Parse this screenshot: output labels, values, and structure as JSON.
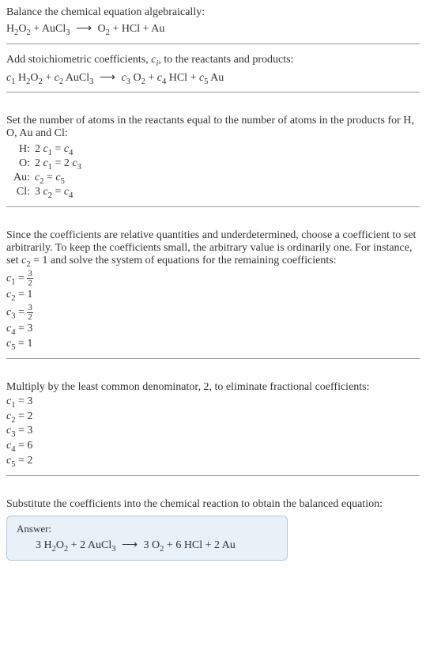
{
  "intro": {
    "line1": "Balance the chemical equation algebraically:",
    "eq_lhs1": "H",
    "eq_lhs1_sub1": "2",
    "eq_lhs1_mid": "O",
    "eq_lhs1_sub2": "2",
    "eq_plus1": " + AuCl",
    "eq_lhs2_sub": "3",
    "arrow": "⟶",
    "eq_rhs1": "O",
    "eq_rhs1_sub": "2",
    "eq_plus2": " + HCl + Au"
  },
  "stoich": {
    "text": "Add stoichiometric coefficients, ",
    "ci": "c",
    "ci_sub": "i",
    "text2": ", to the reactants and products:",
    "c1": "c",
    "c1_sub": "1",
    "sp1": " H",
    "sp1_sub1": "2",
    "sp1_mid": "O",
    "sp1_sub2": "2",
    "plus1": " + ",
    "c2": "c",
    "c2_sub": "2",
    "sp2": " AuCl",
    "sp2_sub": "3",
    "arrow": "⟶",
    "c3": "c",
    "c3_sub": "3",
    "sp3": " O",
    "sp3_sub": "2",
    "plus2": " + ",
    "c4": "c",
    "c4_sub": "4",
    "sp4": " HCl + ",
    "c5": "c",
    "c5_sub": "5",
    "sp5": " Au"
  },
  "atoms": {
    "intro": "Set the number of atoms in the reactants equal to the number of atoms in the products for H, O, Au and Cl:",
    "rows": [
      {
        "label": "H:",
        "eq_pre": "2 ",
        "c_a": "c",
        "c_a_sub": "1",
        "mid": " = ",
        "c_b": "c",
        "c_b_sub": "4",
        "post": ""
      },
      {
        "label": "O:",
        "eq_pre": "2 ",
        "c_a": "c",
        "c_a_sub": "1",
        "mid": " = 2 ",
        "c_b": "c",
        "c_b_sub": "3",
        "post": ""
      },
      {
        "label": "Au:",
        "eq_pre": "",
        "c_a": "c",
        "c_a_sub": "2",
        "mid": " = ",
        "c_b": "c",
        "c_b_sub": "5",
        "post": ""
      },
      {
        "label": "Cl:",
        "eq_pre": "3 ",
        "c_a": "c",
        "c_a_sub": "2",
        "mid": " = ",
        "c_b": "c",
        "c_b_sub": "4",
        "post": ""
      }
    ]
  },
  "solve": {
    "text": "Since the coefficients are relative quantities and underdetermined, choose a coefficient to set arbitrarily. To keep the coefficients small, the arbitrary value is ordinarily one. For instance, set ",
    "cset": "c",
    "cset_sub": "2",
    "text2": " = 1 and solve the system of equations for the remaining coefficients:",
    "items": [
      {
        "c": "c",
        "sub": "1",
        "eq": " = ",
        "frac_num": "3",
        "frac_den": "2",
        "val": ""
      },
      {
        "c": "c",
        "sub": "2",
        "eq": " = 1",
        "frac_num": "",
        "frac_den": "",
        "val": ""
      },
      {
        "c": "c",
        "sub": "3",
        "eq": " = ",
        "frac_num": "3",
        "frac_den": "2",
        "val": ""
      },
      {
        "c": "c",
        "sub": "4",
        "eq": " = 3",
        "frac_num": "",
        "frac_den": "",
        "val": ""
      },
      {
        "c": "c",
        "sub": "5",
        "eq": " = 1",
        "frac_num": "",
        "frac_den": "",
        "val": ""
      }
    ]
  },
  "mult": {
    "text": "Multiply by the least common denominator, 2, to eliminate fractional coefficients:",
    "items": [
      {
        "c": "c",
        "sub": "1",
        "eq": " = 3"
      },
      {
        "c": "c",
        "sub": "2",
        "eq": " = 2"
      },
      {
        "c": "c",
        "sub": "3",
        "eq": " = 3"
      },
      {
        "c": "c",
        "sub": "4",
        "eq": " = 6"
      },
      {
        "c": "c",
        "sub": "5",
        "eq": " = 2"
      }
    ]
  },
  "final": {
    "text": "Substitute the coefficients into the chemical reaction to obtain the balanced equation:",
    "answer_label": "Answer:",
    "eq_pre1": "3 H",
    "sub1": "2",
    "mid1": "O",
    "sub2": "2",
    "plus1": " + 2 AuCl",
    "sub3": "3",
    "arrow": "⟶",
    "eq_pre2": "3 O",
    "sub4": "2",
    "plus2": " + 6 HCl + 2 Au"
  }
}
